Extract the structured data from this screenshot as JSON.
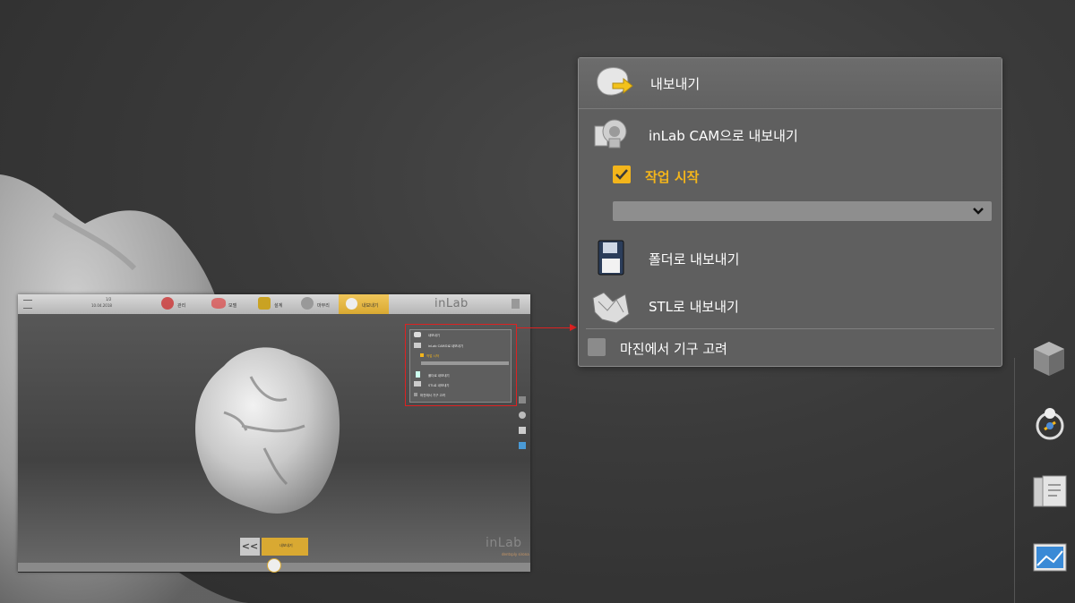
{
  "export_panel": {
    "title": "내보내기",
    "cam_export_label": "inLab CAM으로 내보내기",
    "start_job_label": "작업 시작",
    "start_job_checked": true,
    "dropdown_value": "",
    "folder_export_label": "폴더로 내보내기",
    "stl_export_label": "STL로 내보내기",
    "margin_instrument_label": "마진에서 기구 고려",
    "margin_instrument_checked": false
  },
  "right_toolbar": {
    "icons": [
      "cube-view-icon",
      "light-icon",
      "documents-icon",
      "screenshot-icon"
    ]
  },
  "thumbnail": {
    "date_line1": "1/2",
    "date_line2": "10.04.2018",
    "steps": [
      "관리",
      "모델",
      "설계",
      "마무리",
      "내보내기"
    ],
    "logo": "inLab",
    "logo_bottom": "inLab",
    "logo_sub": "dentsply sirona",
    "mini_panel": {
      "title": "내보내기",
      "cam_export_label": "inLab CAM으로 내보내기",
      "start_job_label": "작업 시작",
      "folder_export_label": "폴더로 내보내기",
      "stl_export_label": "STL로 내보내기",
      "margin_instrument_label": "마진에서 기구 고려"
    },
    "nav_back_label": "<<",
    "nav_current_label": "내보내기"
  },
  "colors": {
    "accent": "#f3b51b",
    "panel_bg": "#5f5f5f",
    "highlight_red": "#dd2222"
  }
}
